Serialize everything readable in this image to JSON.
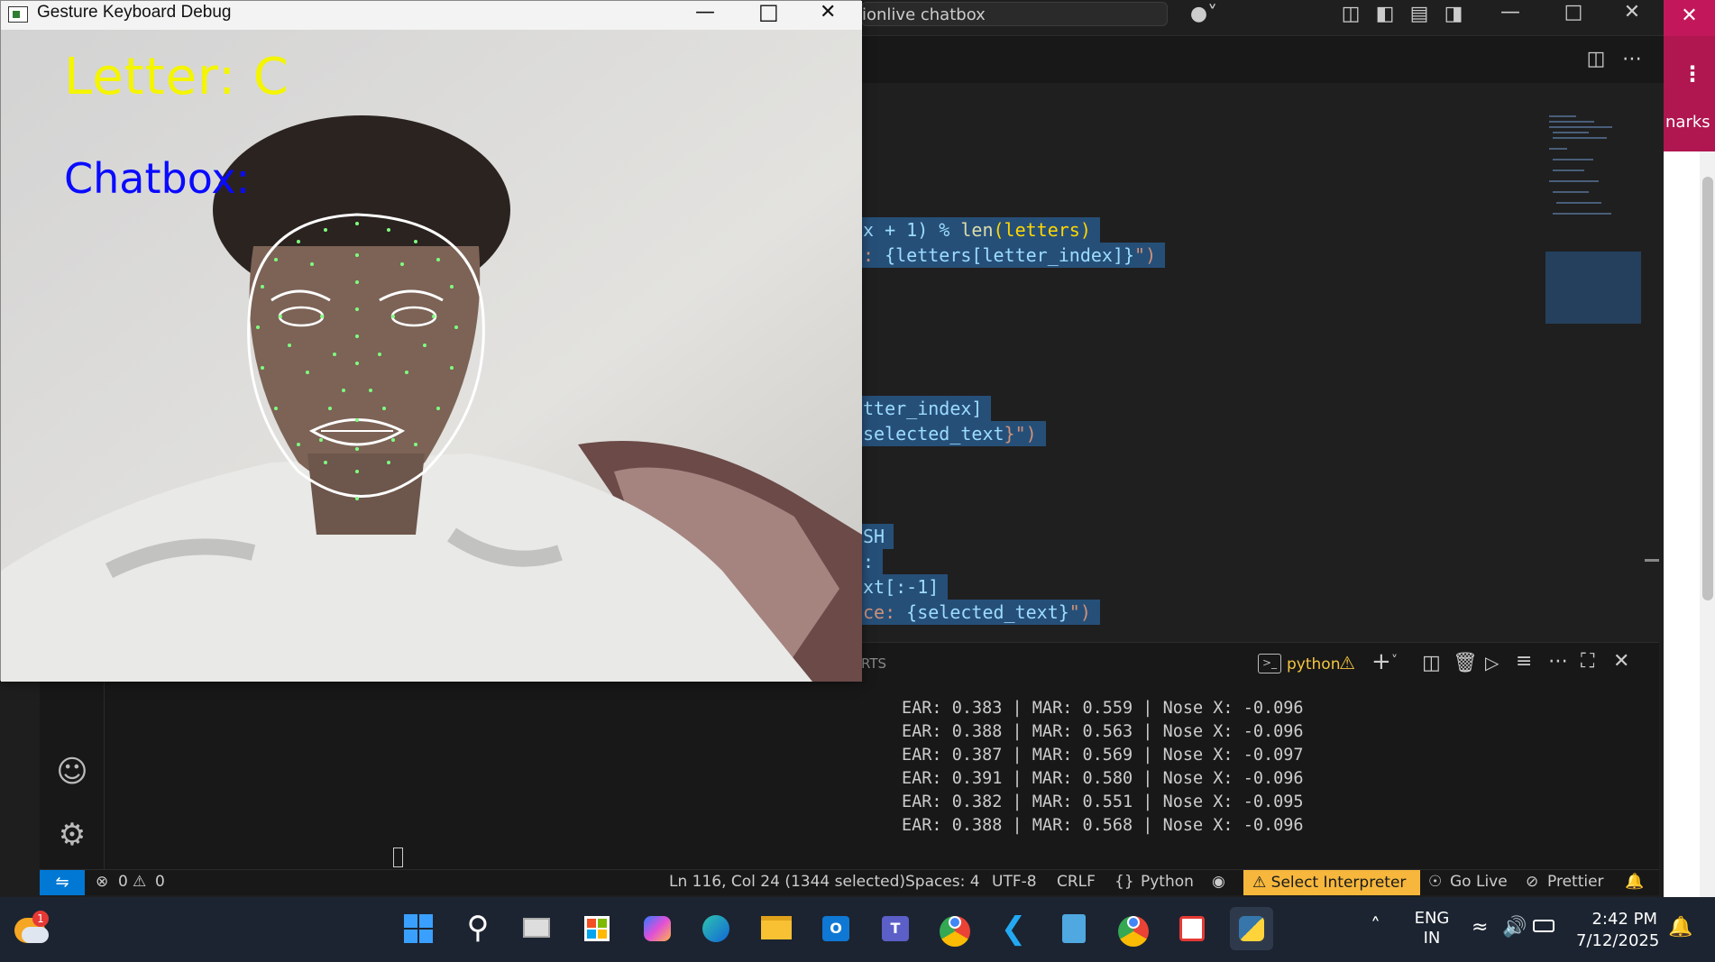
{
  "vscode": {
    "search_text": "ionlive chatbox",
    "code_lines": [
      {
        "t1": "x + 1) % ",
        "t2": "len",
        "t3": "(letters)"
      },
      {
        "t1": ": ",
        "t2": "{letters[letter_index]}",
        "t3": "\")"
      },
      {
        "t1": "tter_index]",
        "t2": "",
        "t3": ""
      },
      {
        "t1": "selected_text",
        "t2": "}\")",
        "t3": ""
      },
      {
        "t1": "SH",
        "t2": "",
        "t3": ""
      },
      {
        "t1": ":",
        "t2": "",
        "t3": ""
      },
      {
        "t1": "xt[:-1]",
        "t2": "",
        "t3": ""
      },
      {
        "t1": "ce: ",
        "t2": "{selected_text}",
        "t3": "\")"
      }
    ],
    "panel_tab_partial": "RTS",
    "terminal_name": "python",
    "terminal_lines": [
      "EAR: 0.383 | MAR: 0.559 | Nose X: -0.096",
      "EAR: 0.388 | MAR: 0.563 | Nose X: -0.096",
      "EAR: 0.387 | MAR: 0.569 | Nose X: -0.097",
      "EAR: 0.391 | MAR: 0.580 | Nose X: -0.096",
      "EAR: 0.382 | MAR: 0.551 | Nose X: -0.095",
      "EAR: 0.388 | MAR: 0.568 | Nose X: -0.096"
    ],
    "status": {
      "errors": "0",
      "warnings": "0",
      "position": "Ln 116, Col 24 (1344 selected)",
      "spaces": "Spaces: 4",
      "encoding": "UTF-8",
      "eol": "CRLF",
      "language": "Python",
      "interpreter": "Select Interpreter",
      "golive": "Go Live",
      "prettier": "Prettier"
    }
  },
  "camera_window": {
    "title": "Gesture Keyboard Debug",
    "overlay_letter": "Letter: C",
    "overlay_chatbox": "Chatbox:"
  },
  "browser_sliver": {
    "text": "narks"
  },
  "taskbar": {
    "weather_badge": "1",
    "lang_top": "ENG",
    "lang_bottom": "IN",
    "time": "2:42 PM",
    "date": "7/12/2025"
  },
  "colors": {
    "letter_overlay": "#f5f500",
    "chatbox_overlay": "#0a0aff",
    "status_interpreter_bg": "#f6b73c",
    "taskbar_bg": "#1c2431"
  }
}
